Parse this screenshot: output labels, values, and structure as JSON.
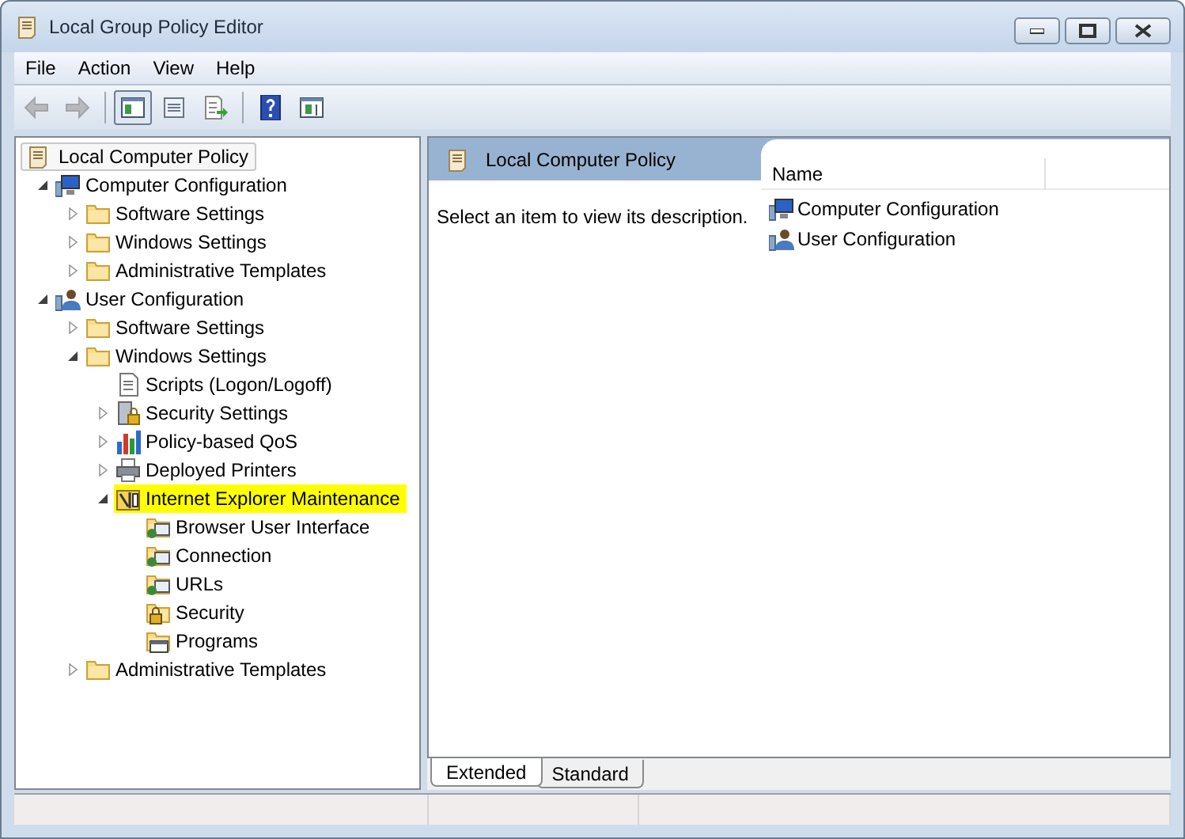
{
  "window": {
    "title": "Local Group Policy Editor"
  },
  "menu": [
    "File",
    "Action",
    "View",
    "Help"
  ],
  "toolbar": [
    {
      "kind": "back",
      "disabled": true,
      "pressed": false
    },
    {
      "kind": "forward",
      "disabled": true,
      "pressed": false
    },
    {
      "kind": "tree",
      "disabled": false,
      "pressed": true
    },
    {
      "kind": "properties",
      "disabled": false,
      "pressed": false
    },
    {
      "kind": "export",
      "disabled": false,
      "pressed": false
    },
    {
      "kind": "help",
      "disabled": false,
      "pressed": false
    },
    {
      "kind": "actionpane",
      "disabled": false,
      "pressed": false
    }
  ],
  "tree": {
    "label": "Local Computer Policy",
    "kind": "scroll",
    "children": [
      {
        "label": "Computer Configuration",
        "kind": "computer",
        "expanded": true,
        "selected": false,
        "children": [
          {
            "label": "Software Settings",
            "kind": "folder",
            "expanded": false,
            "selected": false
          },
          {
            "label": "Windows Settings",
            "kind": "folder",
            "expanded": false,
            "selected": false
          },
          {
            "label": "Administrative Templates",
            "kind": "folder",
            "expanded": false,
            "selected": false
          }
        ]
      },
      {
        "label": "User Configuration",
        "kind": "user",
        "expanded": true,
        "selected": false,
        "children": [
          {
            "label": "Software Settings",
            "kind": "folder",
            "expanded": false,
            "selected": false
          },
          {
            "label": "Windows Settings",
            "kind": "folder",
            "expanded": true,
            "selected": false,
            "children": [
              {
                "label": "Scripts (Logon/Logoff)",
                "kind": "scripts",
                "selected": false
              },
              {
                "label": "Security Settings",
                "kind": "security",
                "expanded": false,
                "selected": false
              },
              {
                "label": "Policy-based QoS",
                "kind": "chart",
                "expanded": false,
                "selected": false
              },
              {
                "label": "Deployed Printers",
                "kind": "printer",
                "expanded": false,
                "selected": false
              },
              {
                "label": "Internet Explorer Maintenance",
                "kind": "iem",
                "expanded": true,
                "selected": true,
                "children": [
                  {
                    "label": "Browser User Interface",
                    "kind": "iefolder",
                    "selected": false
                  },
                  {
                    "label": "Connection",
                    "kind": "iefolder",
                    "selected": false
                  },
                  {
                    "label": "URLs",
                    "kind": "iefolder",
                    "selected": false
                  },
                  {
                    "label": "Security",
                    "kind": "lockfolder",
                    "selected": false
                  },
                  {
                    "label": "Programs",
                    "kind": "progfolder",
                    "selected": false
                  }
                ]
              }
            ]
          },
          {
            "label": "Administrative Templates",
            "kind": "folder",
            "expanded": false,
            "selected": false
          }
        ]
      }
    ]
  },
  "details": {
    "header": "Local Computer Policy",
    "description": "Select an item to view its description.",
    "columns": [
      "Name"
    ],
    "items": [
      {
        "label": "Computer Configuration",
        "kind": "computer"
      },
      {
        "label": "User Configuration",
        "kind": "user"
      }
    ]
  },
  "tabs": [
    {
      "label": "Extended",
      "selected": true
    },
    {
      "label": "Standard",
      "selected": false
    }
  ]
}
